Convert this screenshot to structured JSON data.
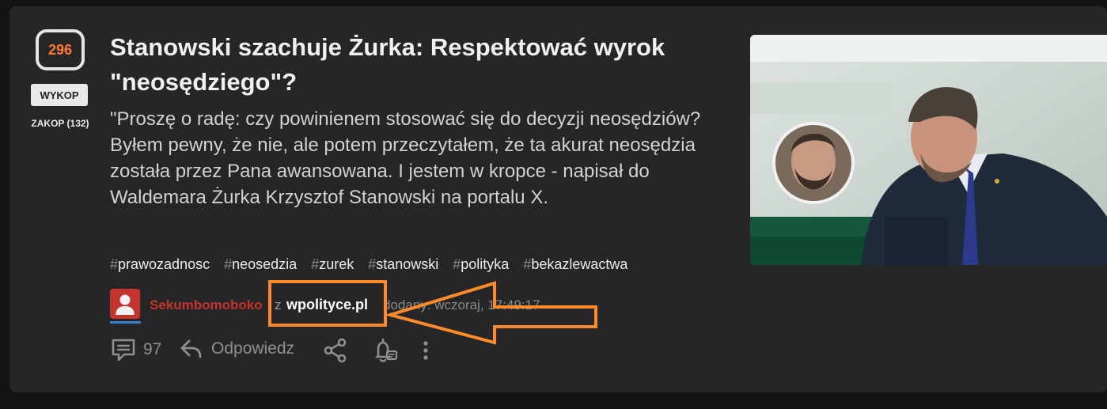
{
  "post": {
    "votes": "296",
    "wykop_label": "WYKOP",
    "zakop_label": "ZAKOP (132)",
    "title": "Stanowski szachuje Żurka: Respektować wyrok \"neosędziego\"?",
    "description": "\"Proszę o radę: czy powinienem stosować się do decyzji neosędziów? Byłem pewny, że nie, ale potem przeczytałem, że ta akurat neosędzia została przez Pana awansowana. I jestem w kropce - napisał do Waldemara Żurka Krzysztof Stanowski na portalu X.",
    "tags": [
      "prawozadnosc",
      "neosedzia",
      "zurek",
      "stanowski",
      "polityka",
      "bekazlewactwa"
    ],
    "author": "Sekumbomoboko",
    "from_word": "z",
    "source": "wpolityce.pl",
    "added": "dodany: wczoraj, 17:49:17",
    "comments_count": "97",
    "reply_label": "Odpowiedz"
  },
  "colors": {
    "background": "#131313",
    "card": "#262628",
    "accent_votes": "#ff7a33",
    "author": "#c4332e",
    "annotation": "#ff8a2a"
  },
  "icons": [
    "comments-icon",
    "reply-icon",
    "share-icon",
    "notification-bell-icon",
    "more-options-icon",
    "user-avatar-icon"
  ]
}
